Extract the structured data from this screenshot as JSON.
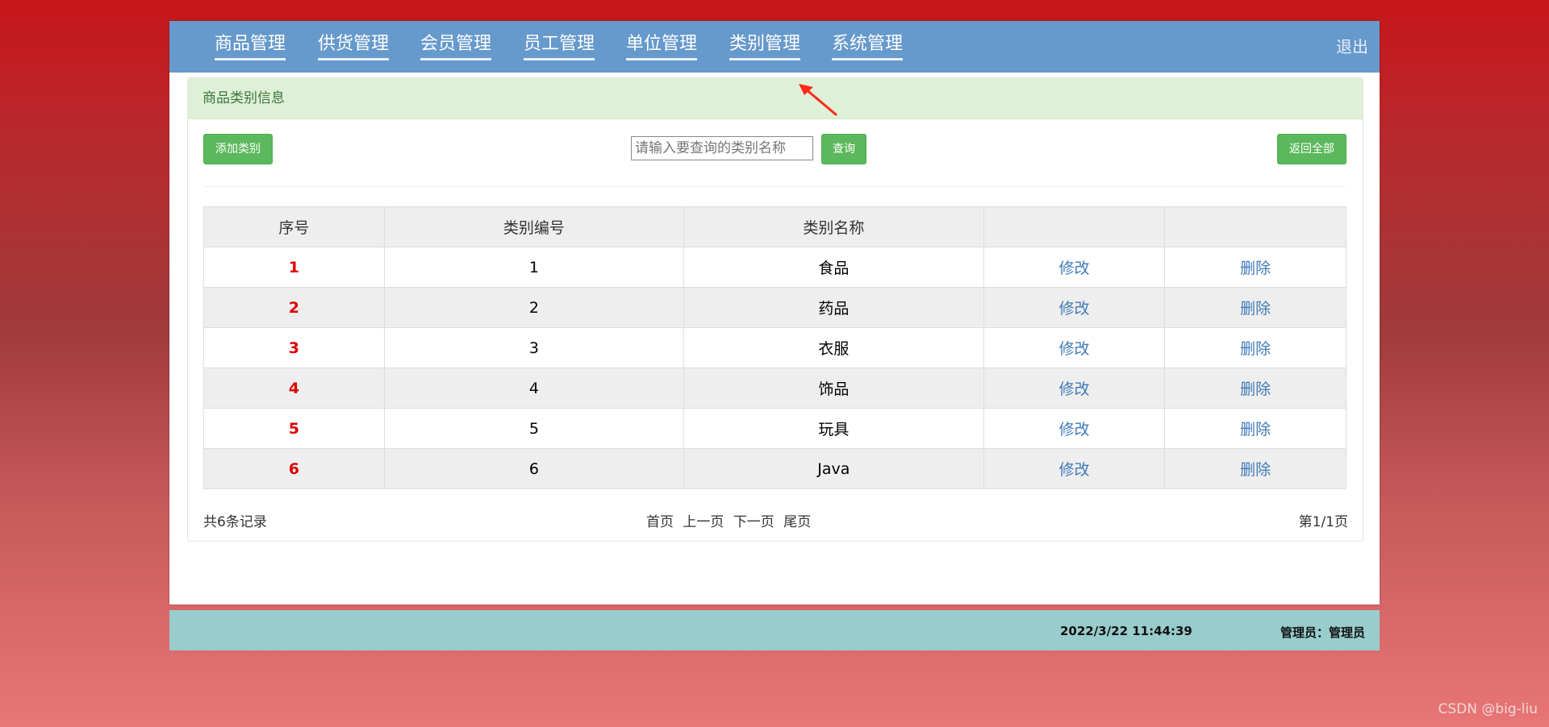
{
  "nav": {
    "items": [
      "商品管理",
      "供货管理",
      "会员管理",
      "员工管理",
      "单位管理",
      "类别管理",
      "系统管理"
    ],
    "logout": "退出"
  },
  "panel": {
    "title": "商品类别信息",
    "add_button": "添加类别",
    "search_placeholder": "请输入要查询的类别名称",
    "search_button": "查询",
    "return_button": "返回全部"
  },
  "table": {
    "headers": [
      "序号",
      "类别编号",
      "类别名称",
      "",
      ""
    ],
    "rows": [
      {
        "index": "1",
        "code": "1",
        "name": "食品",
        "edit": "修改",
        "delete": "删除"
      },
      {
        "index": "2",
        "code": "2",
        "name": "药品",
        "edit": "修改",
        "delete": "删除"
      },
      {
        "index": "3",
        "code": "3",
        "name": "衣服",
        "edit": "修改",
        "delete": "删除"
      },
      {
        "index": "4",
        "code": "4",
        "name": "饰品",
        "edit": "修改",
        "delete": "删除"
      },
      {
        "index": "5",
        "code": "5",
        "name": "玩具",
        "edit": "修改",
        "delete": "删除"
      },
      {
        "index": "6",
        "code": "6",
        "name": "Java",
        "edit": "修改",
        "delete": "删除"
      }
    ]
  },
  "pagination": {
    "total": "共6条记录",
    "first": "首页",
    "prev": "上一页",
    "next": "下一页",
    "last": "尾页",
    "page_info": "第1/1页"
  },
  "status": {
    "datetime": "2022/3/22 11:44:39",
    "user": "管理员：管理员"
  },
  "watermark": "CSDN @big-liu",
  "colors": {
    "nav_bg": "#6699cc",
    "panel_heading_bg": "#dff0d8",
    "button_green": "#5cb85c",
    "index_red": "#e00000",
    "link_blue": "#3f7ab8",
    "statusbar_bg": "#99cccc"
  }
}
